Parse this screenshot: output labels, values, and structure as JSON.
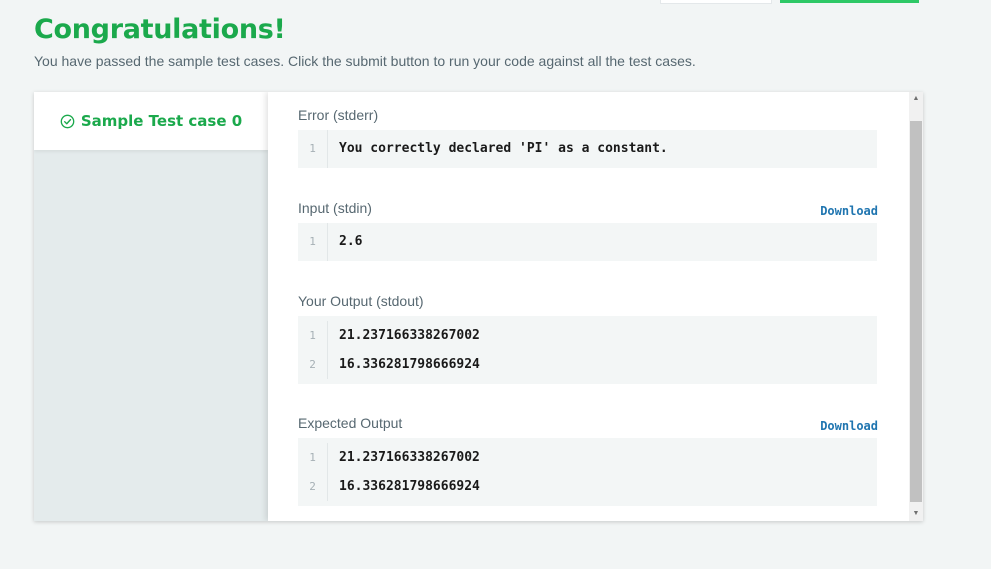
{
  "header": {
    "title": "Congratulations!",
    "subtitle": "You have passed the sample test cases. Click the submit button to run your code against all the test cases."
  },
  "tabs": [
    {
      "label": "Sample Test case 0",
      "icon": "check-circle-icon",
      "status": "passed"
    }
  ],
  "sections": {
    "error": {
      "label": "Error (stderr)",
      "lines": [
        {
          "num": "1",
          "text": "You correctly declared 'PI' as a constant."
        }
      ]
    },
    "input": {
      "label": "Input (stdin)",
      "download": "Download",
      "lines": [
        {
          "num": "1",
          "text": "2.6"
        }
      ]
    },
    "your_output": {
      "label": "Your Output (stdout)",
      "lines": [
        {
          "num": "1",
          "text": "21.237166338267002"
        },
        {
          "num": "2",
          "text": "16.336281798666924"
        }
      ]
    },
    "expected_output": {
      "label": "Expected Output",
      "download": "Download",
      "lines": [
        {
          "num": "1",
          "text": "21.237166338267002"
        },
        {
          "num": "2",
          "text": "16.336281798666924"
        }
      ]
    }
  },
  "colors": {
    "success_green": "#1ba94c",
    "submit_green": "#2ec866",
    "link_blue": "#1f75b0",
    "code_bg": "#f3f6f6",
    "page_bg": "#f2f5f5"
  }
}
